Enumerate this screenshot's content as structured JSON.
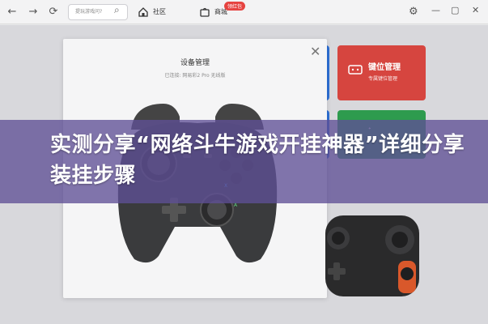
{
  "toolbar": {
    "back": "←",
    "forward": "→",
    "refresh": "⟳",
    "search_placeholder": "提玩游戏问?",
    "tabs": [
      {
        "label": "社区"
      },
      {
        "label": "商城",
        "badge": "领红包"
      }
    ]
  },
  "background": {
    "tile_red": {
      "title": "键位管理",
      "subtitle": "专属键位管理"
    },
    "tile_green": {
      "title": "ᐩ"
    }
  },
  "modal": {
    "title": "设备管理",
    "subtitle": "已连接: 网易彩2 Pro 无线版"
  },
  "headline": "实测分享“网络斗牛游戏开挂神器”详细分享装挂步骤",
  "colors": {
    "overlay": "#5f5096",
    "tile_red": "#d6453f",
    "tile_blue": "#2d6fd6",
    "tile_green": "#2e9b4e"
  }
}
